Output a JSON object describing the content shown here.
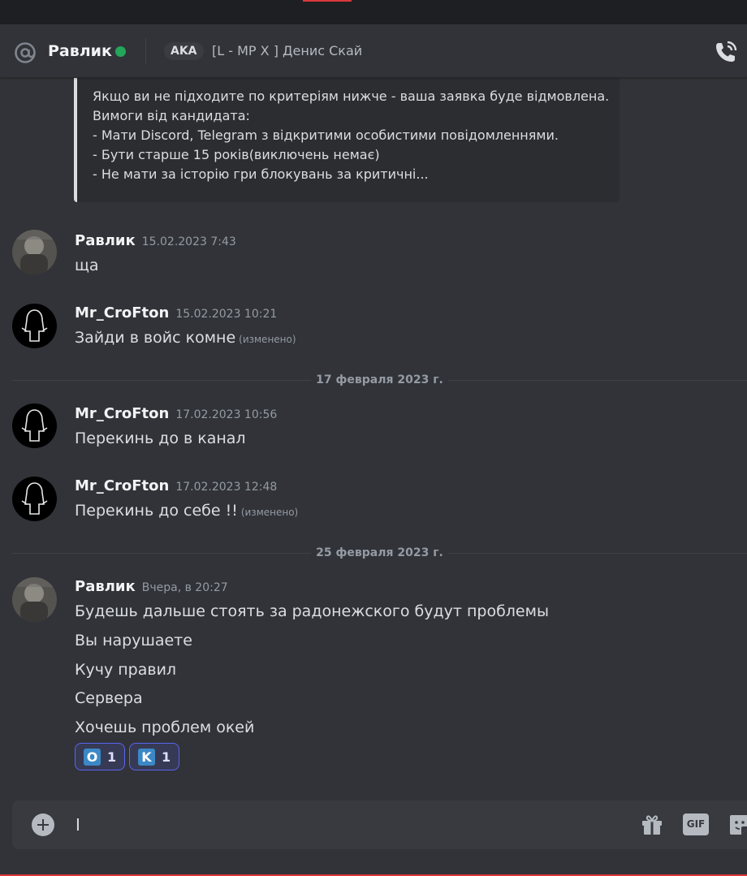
{
  "header": {
    "name": "Равлик",
    "aka_label": "AKA",
    "nickname": "[L - MP X ] Денис Скай"
  },
  "embed": {
    "lines": [
      "Якщо ви не підходите по критеріям нижче - ваша заявка буде відмовлена.",
      "Вимоги від кандидата:",
      "- Мати Discord, Telegram з відкритими особистими повідомленнями.",
      "- Бути старше 15 років(виключень немає)",
      "- Не мати за історію гри блокувань за критичні..."
    ]
  },
  "messages": [
    {
      "author": "Равлик",
      "time": "15.02.2023 7:43",
      "lines": [
        "ща"
      ]
    },
    {
      "author": "Mr_CroFton",
      "time": "15.02.2023 10:21",
      "lines": [
        "Зайди в войс комне"
      ],
      "edited": "(изменено)"
    },
    {
      "author": "Mr_CroFton",
      "time": "17.02.2023 10:56",
      "lines": [
        "Перекинь до в канал"
      ]
    },
    {
      "author": "Mr_CroFton",
      "time": "17.02.2023 12:48",
      "lines": [
        "Перекинь до себе !!"
      ],
      "edited": "(изменено)"
    },
    {
      "author": "Равлик",
      "time": "Вчера, в 20:27",
      "lines": [
        "Будешь дальше стоять за радонежского будут проблемы",
        "Вы нарушаете",
        "Кучу правил",
        "Сервера",
        "Хочешь проблем окей"
      ]
    }
  ],
  "date_separators": [
    "17 февраля 2023 г.",
    "25 февраля 2023 г."
  ],
  "reactions": [
    {
      "emoji": "O",
      "count": "1"
    },
    {
      "emoji": "K",
      "count": "1"
    }
  ],
  "composer": {
    "value": "I",
    "gif_label": "GIF"
  },
  "colors": {
    "background": "#313338",
    "online": "#23a55a",
    "reaction_border": "#5865f2",
    "emoji_blue": "#3c88c6"
  },
  "icons": [
    "at-icon",
    "phone-call-icon",
    "add-attachment-icon",
    "gift-icon",
    "gif-icon",
    "sticker-icon"
  ]
}
